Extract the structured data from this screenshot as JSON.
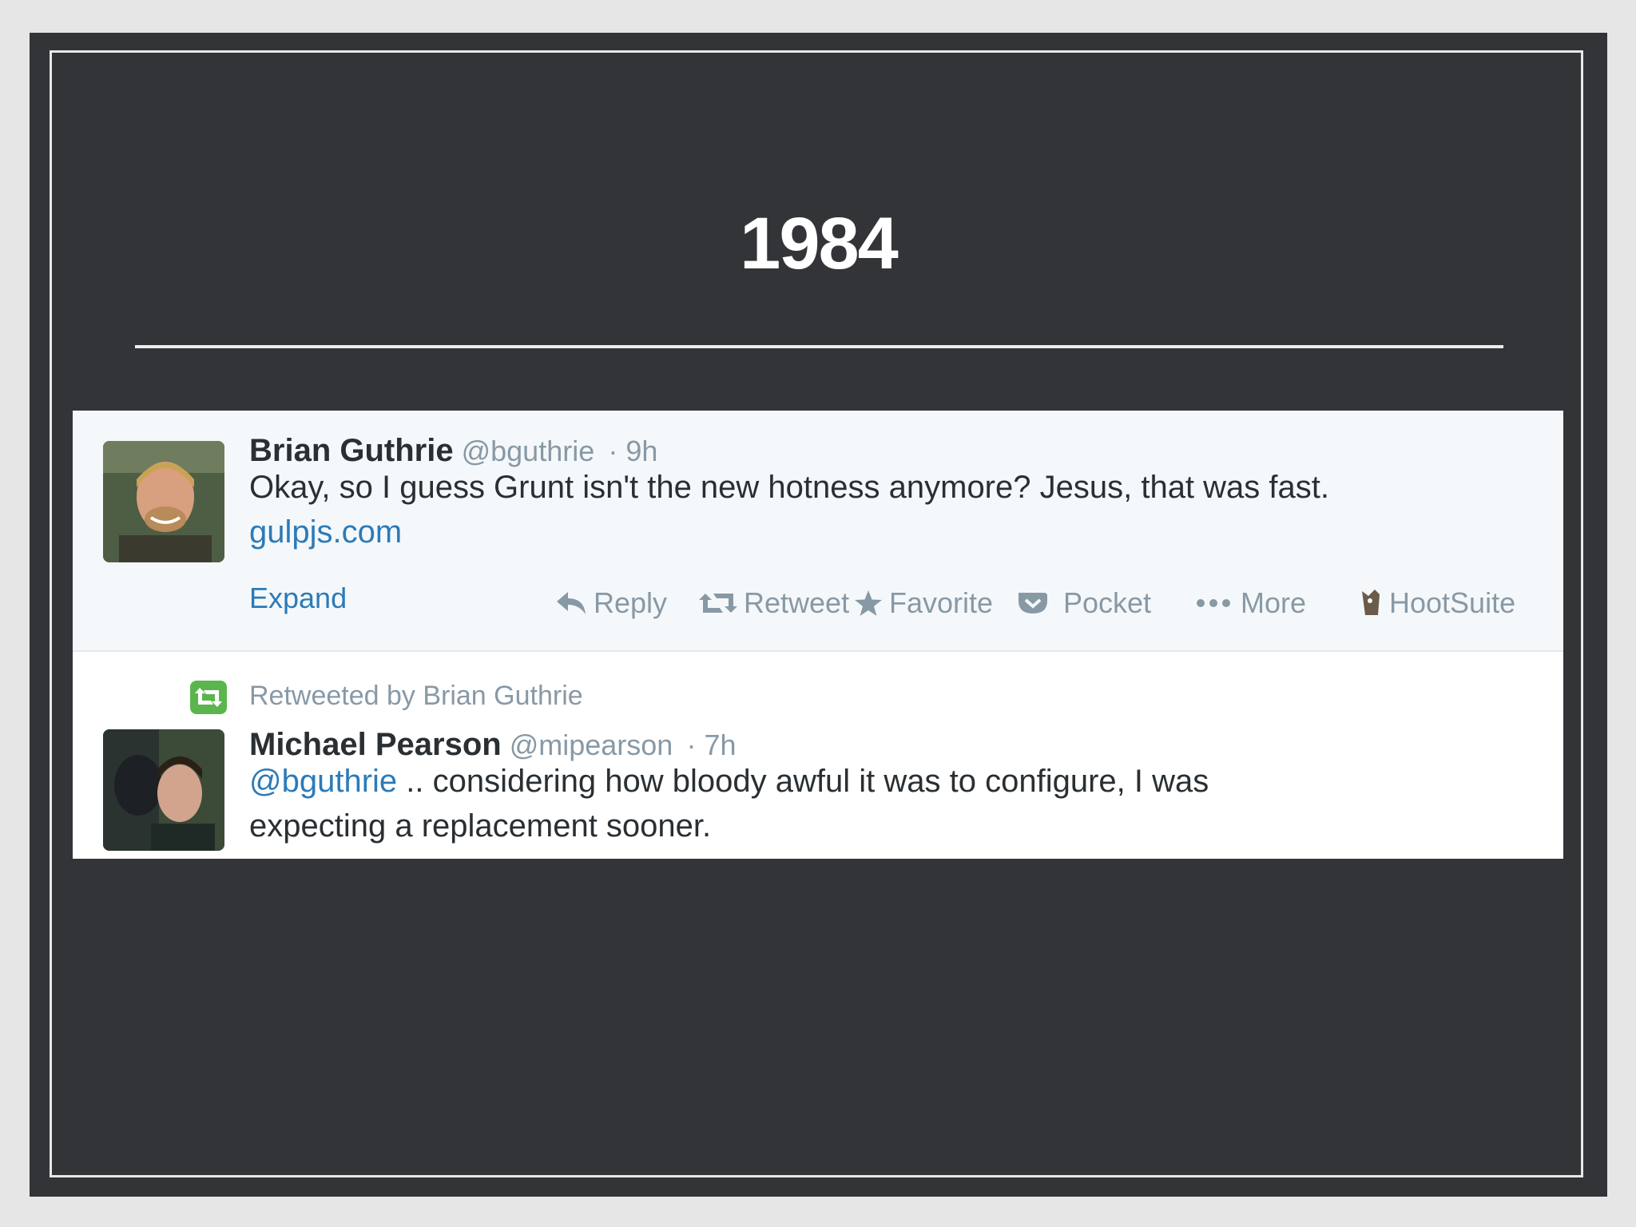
{
  "slide": {
    "title": "1984"
  },
  "tweet1": {
    "name": "Brian Guthrie",
    "handle": "@bguthrie",
    "time": "· 9h",
    "text": "Okay, so I guess Grunt isn't the new hotness anymore? Jesus, that was fast.",
    "link": "gulpjs.com",
    "expand": "Expand",
    "actions": {
      "reply": "Reply",
      "retweet": "Retweet",
      "favorite": "Favorite",
      "pocket": "Pocket",
      "more": "More",
      "hootsuite": "HootSuite"
    }
  },
  "tweet2": {
    "retweeted_by": "Retweeted by Brian Guthrie",
    "name": "Michael Pearson",
    "handle": "@mipearson",
    "time": "· 7h",
    "mention": "@bguthrie",
    "text_line1": " .. considering how bloody awful it was to configure, I was",
    "text_line2": "expecting a replacement sooner."
  },
  "colors": {
    "slide_bg": "#333438",
    "link": "#2b7bb9",
    "muted": "#8899a6",
    "retweet_green": "#5ab64c"
  }
}
